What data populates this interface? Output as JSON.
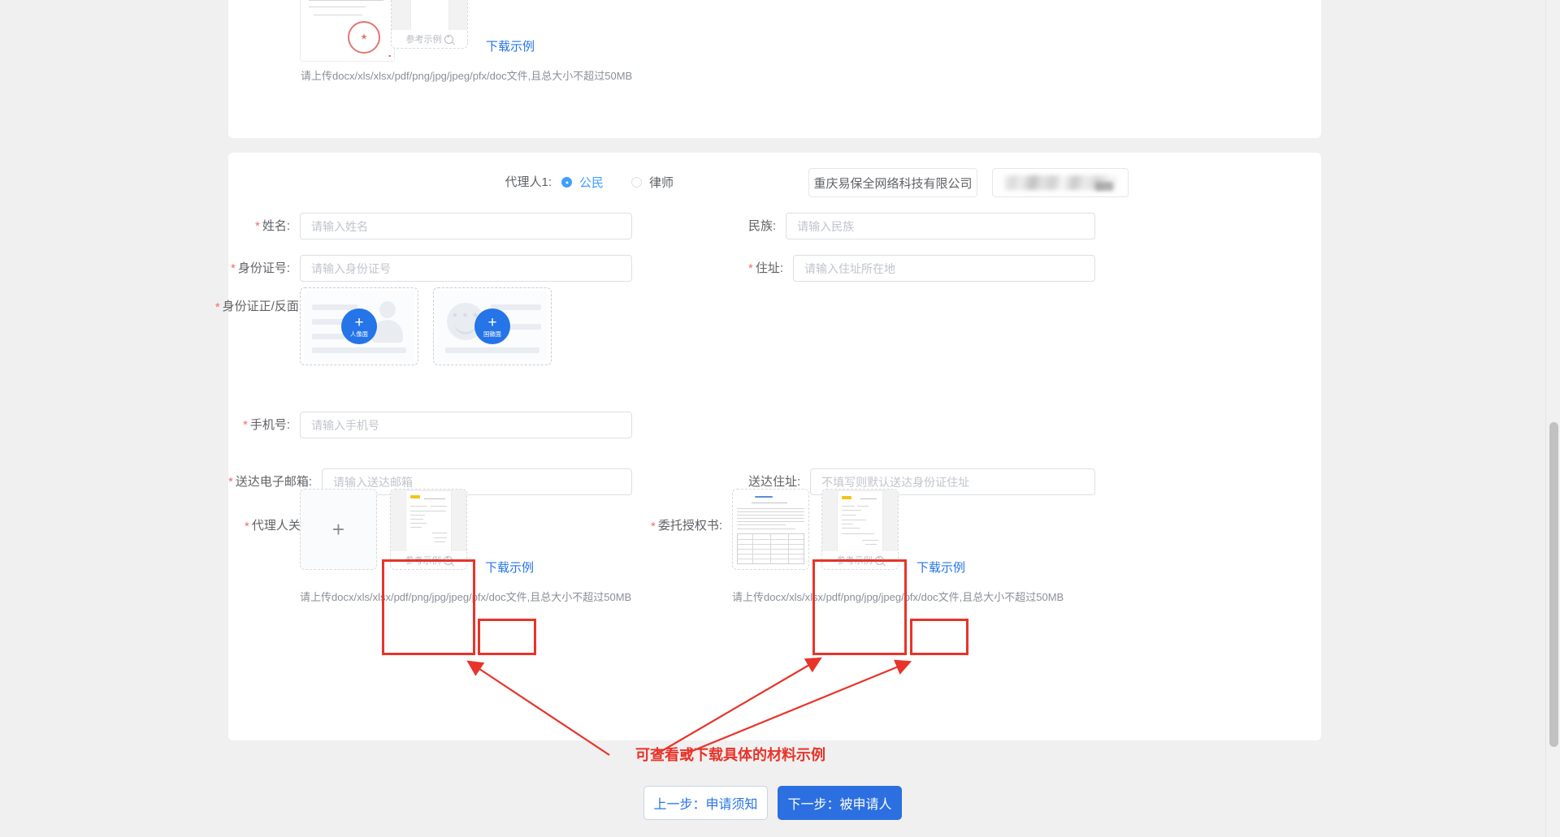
{
  "colors": {
    "accent": "#2574e8",
    "radio_active": "#409eff",
    "annotation_red": "#e8342a",
    "required_star": "#f56c6c",
    "primary_button": "#2c6fe0"
  },
  "top_card": {
    "example_caption": "参考示例",
    "download_label": "下载示例",
    "upload_hint": "请上传docx/xls/xlsx/pdf/png/jpg/jpeg/pfx/doc文件,且总大小不超过50MB"
  },
  "agent_section": {
    "title_label": "代理人1:",
    "type_options": [
      {
        "label": "公民",
        "selected": true
      },
      {
        "label": "律师",
        "selected": false
      }
    ],
    "org_name": "重庆易保全网络科技有限公司",
    "org_secondary": "",
    "fields": {
      "name": {
        "label": "姓名:",
        "required": true,
        "value": "",
        "placeholder": "请输入姓名"
      },
      "ethnicity": {
        "label": "民族:",
        "required": false,
        "value": "",
        "placeholder": "请输入民族"
      },
      "id_number": {
        "label": "身份证号:",
        "required": true,
        "value": "",
        "placeholder": "请输入身份证号"
      },
      "address": {
        "label": "住址:",
        "required": true,
        "value": "",
        "placeholder": "请输入住址所在地"
      },
      "phone": {
        "label": "手机号:",
        "required": true,
        "value": "",
        "placeholder": "请输入手机号"
      },
      "email": {
        "label": "送达电子邮箱:",
        "required": true,
        "value": "",
        "placeholder": "请输入送达邮箱"
      },
      "delivery_address": {
        "label": "送达住址:",
        "required": false,
        "value": "",
        "placeholder": "不填写则默认送达身份证住址"
      }
    },
    "id_card": {
      "label": "身份证正/反面:",
      "required": true,
      "front_button": "人像面",
      "back_button": "国徽面",
      "plus": "+"
    },
    "relation_proof": {
      "label": "代理人关系证明:",
      "required": true,
      "plus": "+",
      "example_caption": "参考示例",
      "download_label": "下载示例",
      "upload_hint": "请上传docx/xls/xlsx/pdf/png/jpg/jpeg/pfx/doc文件,且总大小不超过50MB"
    },
    "power_of_attorney": {
      "label": "委托授权书:",
      "required": true,
      "example_caption": "参考示例",
      "download_label": "下载示例",
      "upload_hint": "请上传docx/xls/xlsx/pdf/png/jpg/jpeg/pfx/doc文件,且总大小不超过50MB"
    }
  },
  "annotation": {
    "text": "可查看或下载具体的材料示例"
  },
  "footer": {
    "prev_label": "上一步：申请须知",
    "next_label": "下一步：被申请人"
  }
}
